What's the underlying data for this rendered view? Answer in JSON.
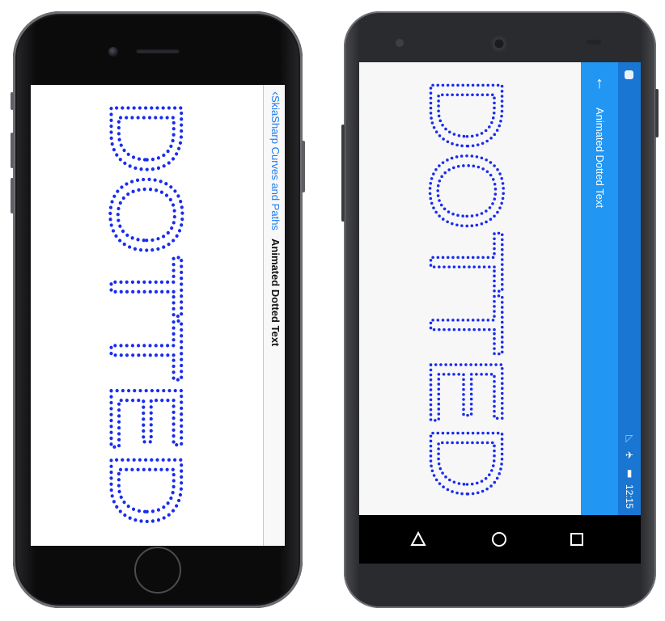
{
  "word": "DOTTED",
  "colors": {
    "dot": "#1a2cf0",
    "ios_accent": "#1e7cf0",
    "android_appbar": "#2196f3",
    "android_statusbar": "#1976d2"
  },
  "ios": {
    "back_label": "SkiaSharp Curves and Paths",
    "title": "Animated Dotted Text"
  },
  "android": {
    "title": "Animated Dotted Text",
    "time": "12:15"
  }
}
